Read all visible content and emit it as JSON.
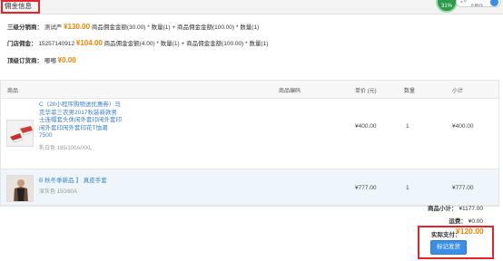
{
  "header": {
    "title": "佣金信息"
  },
  "stat_widget": {
    "percent": "31%",
    "speed": "0.6K/s",
    "count": "0"
  },
  "commission": {
    "level3": {
      "label": "三级分销商：",
      "name": "测试严",
      "amount": "¥130.00",
      "formula": "商品佣金金额(30.00) * 数量(1) + 商品佣金金额(100.00) * 数量(1)"
    },
    "store": {
      "label": "门店佣金：",
      "name": "15257140912",
      "amount": "¥104.00",
      "formula": "商品佣金金额(4.00) * 数量(1) + 商品佣金金额(100.00) * 数量(1)"
    },
    "top": {
      "label": "顶级订货商：",
      "name": "嘟嘟",
      "amount": "¥0.00"
    }
  },
  "table": {
    "headers": {
      "product": "商品",
      "code": "商品编码",
      "price": "单价 (元)",
      "qty": "数量",
      "subtotal": "小计"
    },
    "rows": [
      {
        "name": "C（20小程序购物送优惠券）马克华菲三农男2017秋装新款男士连帽套头休闲外套印闲外套印闲外套印闲外套印花T恤潮7500",
        "name_lines": [
          "C（20小程序购物送优惠券）马",
          "克华菲三农男2017秋装新款男",
          "士连帽套头休闲外套印闲外套印",
          "闲外套印闲外套印花T恤潮",
          "7500"
        ],
        "spec": "乳白色 185/100A/XXL",
        "price": "¥400.00",
        "qty": "1",
        "subtotal": "¥400.00"
      },
      {
        "name": "B 秋冬季新品 】 真皮手套",
        "spec": "深灰色 150/80A",
        "price": "¥777.00",
        "qty": "1",
        "subtotal": "¥777.00"
      }
    ]
  },
  "totals": {
    "subtotal_label": "商品小计：",
    "subtotal": "¥1177.00",
    "freight_label": "运费：",
    "freight": "¥0.00",
    "pay_label": "实际支付：",
    "pay": "¥120.00"
  },
  "actions": {
    "mark_shipped": "标记发货"
  },
  "colors": {
    "accent": "#f08300",
    "highlight": "#e3242b",
    "button": "#3a8ee6",
    "link": "#3a7fc4"
  }
}
